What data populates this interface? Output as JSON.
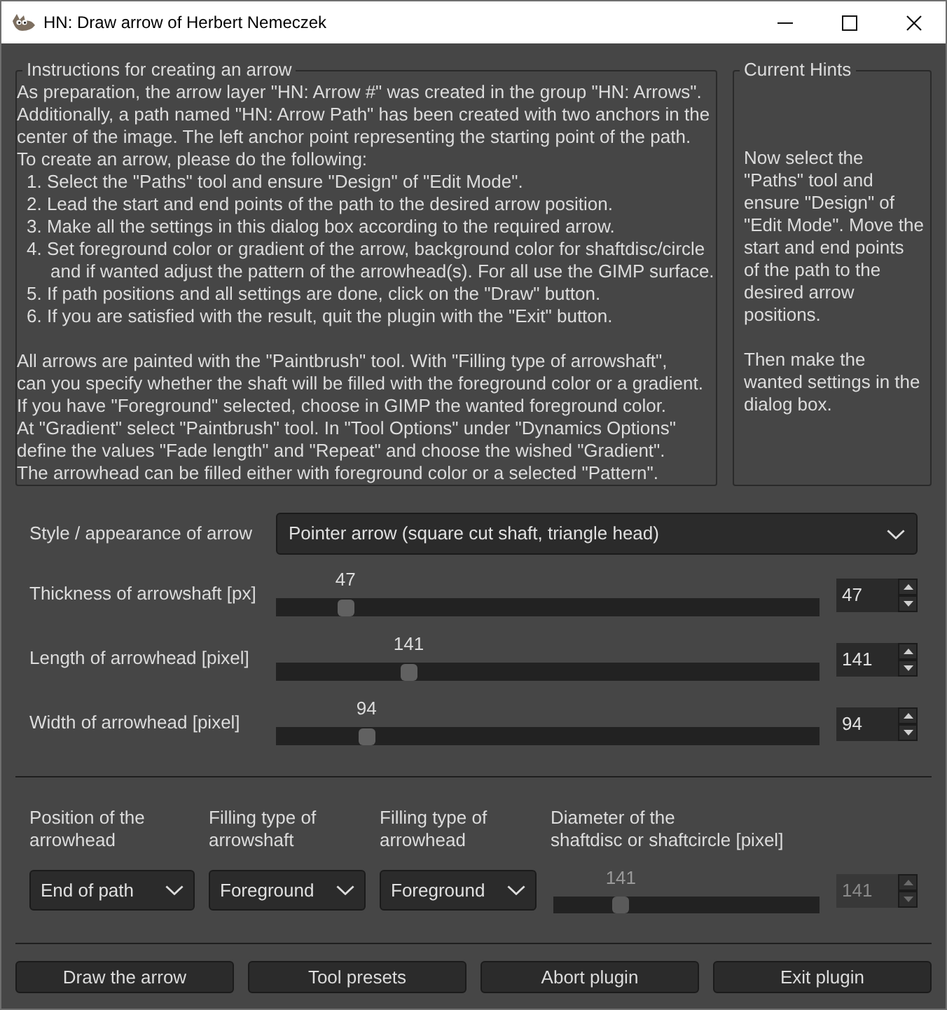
{
  "window": {
    "title": "HN: Draw arrow of Herbert Nemeczek"
  },
  "instructions": {
    "title": "Instructions for creating an arrow",
    "intro": [
      "As preparation, the arrow layer \"HN: Arrow #\" was created in the group \"HN: Arrows\".",
      "Additionally, a path named \"HN: Arrow Path\" has been created with two anchors in the",
      "center of the image. The left anchor point representing the starting point of the path.",
      "To create an arrow, please do the following:"
    ],
    "steps": [
      [
        "1. Select the \"Paths\" tool and ensure \"Design\" of \"Edit Mode\"."
      ],
      [
        "2. Lead the start and end points of the path to the desired arrow position."
      ],
      [
        "3. Make all the settings in this dialog box according to the required arrow."
      ],
      [
        "4. Set foreground color or gradient of the arrow, background color for shaftdisc/circle",
        "and if wanted adjust the pattern of the arrowhead(s). For all use the GIMP surface."
      ],
      [
        "5. If path positions and all settings are done, click on the \"Draw\" button."
      ],
      [
        "6. If you are satisfied with the result, quit the plugin with the \"Exit\" button."
      ]
    ],
    "notes": [
      "All arrows are painted with the \"Paintbrush\" tool. With \"Filling type of arrowshaft\",",
      "can you specify whether the shaft will be filled with the foreground color or a gradient.",
      "If you have \"Foreground\" selected, choose in GIMP the wanted foreground color.",
      "At \"Gradient\" select \"Paintbrush\" tool. In \"Tool Options\" under \"Dynamics Options\"",
      "define the values \"Fade length\" and \"Repeat\" and choose the wished \"Gradient\".",
      "The arrowhead can be filled either with foreground color or a selected \"Pattern\"."
    ]
  },
  "hints": {
    "title": "Current Hints",
    "paragraphs": [
      [
        "Now select the",
        "\"Paths\" tool and",
        "ensure \"Design\" of",
        "\"Edit Mode\". Move the",
        "start and end points",
        "of the path to the",
        "desired arrow",
        "positions."
      ],
      [
        "Then make the",
        "wanted settings in the",
        "dialog box."
      ]
    ]
  },
  "style": {
    "label": "Style / appearance of arrow",
    "value": "Pointer arrow (square cut shaft, triangle head)"
  },
  "sliders": [
    {
      "label": "Thickness of arrowshaft [px]",
      "value": "47",
      "level": 0.116,
      "spin_value": "47"
    },
    {
      "label": "Length of arrowhead [pixel]",
      "value": "141",
      "level": 0.236,
      "spin_value": "141"
    },
    {
      "label": "Width of arrowhead [pixel]",
      "value": "94",
      "level": 0.156,
      "spin_value": "94"
    }
  ],
  "options": [
    {
      "kind": "dropdown",
      "label_lines": [
        "Position of the",
        "arrowhead"
      ],
      "value": "End of path",
      "disabled": false
    },
    {
      "kind": "dropdown",
      "label_lines": [
        "Filling type of",
        "arrowshaft"
      ],
      "value": "Foreground",
      "disabled": false
    },
    {
      "kind": "dropdown",
      "label_lines": [
        "Filling type of",
        "arrowhead"
      ],
      "value": "Foreground",
      "disabled": false
    },
    {
      "kind": "slider",
      "label_lines": [
        "Diameter of the",
        "shaftdisc or shaftcircle [pixel]"
      ],
      "value": "141",
      "level": 0.237,
      "spin_value": "141",
      "disabled": true
    }
  ],
  "buttons": [
    "Draw the arrow",
    "Tool presets",
    "Abort plugin",
    "Exit plugin"
  ]
}
